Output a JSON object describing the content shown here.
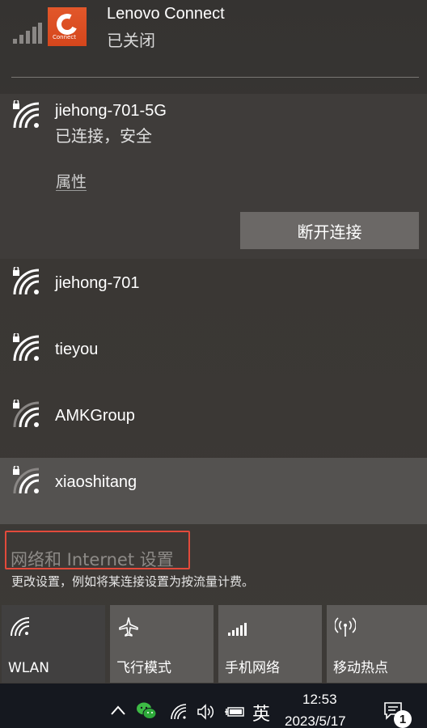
{
  "lenovo_connect": {
    "title": "Lenovo Connect",
    "status": "已关闭",
    "logo_text": "Connect"
  },
  "connected_network": {
    "name": "jiehong-701-5G",
    "status": "已连接，安全",
    "properties_label": "属性",
    "disconnect_label": "断开连接"
  },
  "networks": [
    {
      "name": "jiehong-701",
      "signal": "full"
    },
    {
      "name": "tieyou",
      "signal": "full"
    },
    {
      "name": "AMKGroup",
      "signal": "medium"
    },
    {
      "name": "xiaoshitang",
      "signal": "medium"
    }
  ],
  "settings": {
    "link_label": "网络和 Internet 设置",
    "description": "更改设置，例如将某连接设置为按流量计费。"
  },
  "quick_actions": [
    {
      "label": "WLAN",
      "icon": "wifi-icon",
      "active": true
    },
    {
      "label": "飞行模式",
      "icon": "airplane-icon",
      "active": false
    },
    {
      "label": "手机网络",
      "icon": "cellular-icon",
      "active": false
    },
    {
      "label": "移动热点",
      "icon": "hotspot-icon",
      "active": false
    }
  ],
  "taskbar": {
    "ime_label": "英",
    "time": "12:53",
    "date": "2023/5/17",
    "notification_count": "1"
  },
  "colors": {
    "highlight_box": "#e24a3b",
    "lenovo_logo": "#d94d21",
    "taskbar": "#15181f"
  }
}
